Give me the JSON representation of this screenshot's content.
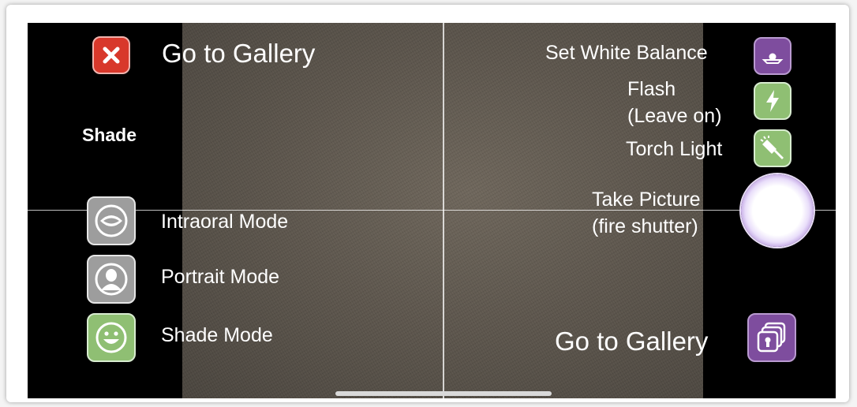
{
  "left": {
    "gallery_label": "Go to Gallery",
    "shade_title": "Shade",
    "modes": [
      {
        "label": "Intraoral Mode",
        "icon": "mouth-icon"
      },
      {
        "label": "Portrait Mode",
        "icon": "person-icon"
      },
      {
        "label": "Shade Mode",
        "icon": "smiley-icon"
      }
    ]
  },
  "right": {
    "white_balance_label": "Set White Balance",
    "flash_label_line1": "Flash",
    "flash_label_line2": "(Leave on)",
    "torch_label": "Torch Light",
    "shutter_label_line1": "Take Picture",
    "shutter_label_line2": "(fire shutter)",
    "gallery_label": "Go to Gallery"
  },
  "colors": {
    "close_red": "#d8382b",
    "mode_gray": "#9d9d9d",
    "active_green": "#8fbf73",
    "brand_purple": "#7e4d9e"
  }
}
